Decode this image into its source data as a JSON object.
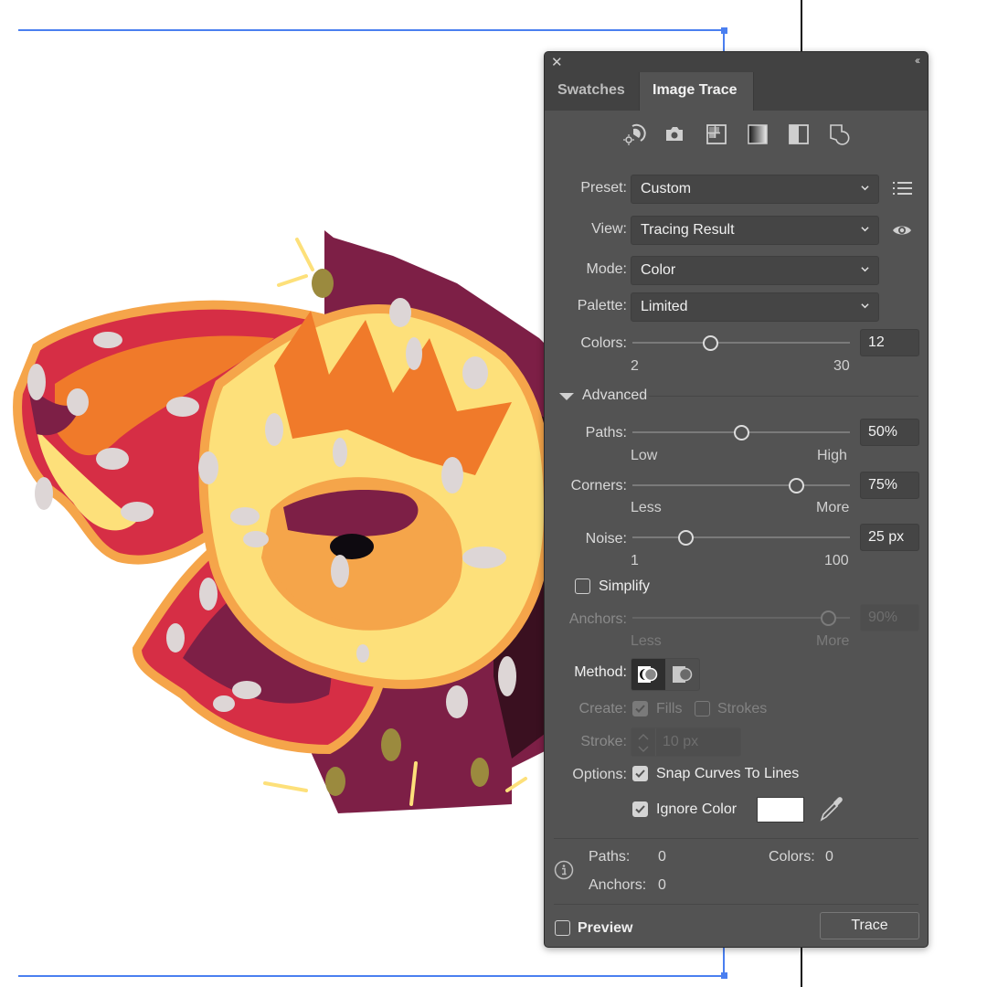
{
  "panel": {
    "tabs": [
      {
        "label": "Swatches",
        "active": false
      },
      {
        "label": "Image Trace",
        "active": true
      }
    ],
    "close_icon": "close-icon",
    "collapse_icon": "double-chevron-left-icon",
    "preset_icons": [
      {
        "name": "auto-color-icon"
      },
      {
        "name": "high-color-icon"
      },
      {
        "name": "low-color-icon"
      },
      {
        "name": "grayscale-icon"
      },
      {
        "name": "black-and-white-icon"
      },
      {
        "name": "outline-icon"
      }
    ],
    "preset": {
      "label": "Preset:",
      "value": "Custom",
      "menu_icon": "list-menu-icon"
    },
    "view": {
      "label": "View:",
      "value": "Tracing Result",
      "toggle_icon": "eye-icon"
    },
    "mode": {
      "label": "Mode:",
      "value": "Color"
    },
    "palette": {
      "label": "Palette:",
      "value": "Limited"
    },
    "colors": {
      "label": "Colors:",
      "value": "12",
      "min": "2",
      "max": "30",
      "numeric": 12,
      "range": [
        2,
        30
      ]
    },
    "advanced": {
      "label": "Advanced",
      "expanded": true
    },
    "paths": {
      "label": "Paths:",
      "value": "50%",
      "min": "Low",
      "max": "High",
      "fraction": 0.5
    },
    "corners": {
      "label": "Corners:",
      "value": "75%",
      "min": "Less",
      "max": "More",
      "fraction": 0.75
    },
    "noise": {
      "label": "Noise:",
      "value": "25 px",
      "min": "1",
      "max": "100",
      "numeric": 25,
      "range": [
        1,
        100
      ]
    },
    "simplify": {
      "label": "Simplify",
      "checked": false
    },
    "anchors": {
      "label": "Anchors:",
      "value": "90%",
      "min": "Less",
      "max": "More",
      "fraction": 0.9,
      "disabled": true
    },
    "method": {
      "label": "Method:",
      "options": [
        "abutting-method-icon",
        "overlapping-method-icon"
      ],
      "selected": 0
    },
    "create": {
      "label": "Create:",
      "fills": {
        "label": "Fills",
        "checked": true
      },
      "strokes": {
        "label": "Strokes",
        "checked": false
      },
      "disabled": true
    },
    "stroke": {
      "label": "Stroke:",
      "value": "10 px",
      "disabled": true
    },
    "options": {
      "label": "Options:",
      "snap_curves": {
        "label": "Snap Curves To Lines",
        "checked": true
      },
      "ignore_color": {
        "label": "Ignore Color",
        "checked": true,
        "swatch_color": "#ffffff"
      }
    },
    "info": {
      "paths_label": "Paths:",
      "paths_value": "0",
      "colors_label": "Colors:",
      "colors_value": "0",
      "anchors_label": "Anchors:",
      "anchors_value": "0"
    },
    "preview": {
      "label": "Preview",
      "checked": false
    },
    "trace_button": "Trace"
  },
  "canvas": {
    "guide_color": "#4a7ff0",
    "artwork": "traced flower illustration",
    "palette_colors": [
      "#7d1f46",
      "#d62e45",
      "#f07a2a",
      "#f5a54a",
      "#fde07a",
      "#ddd6d6",
      "#9b8a3e",
      "#1a0f14"
    ]
  }
}
